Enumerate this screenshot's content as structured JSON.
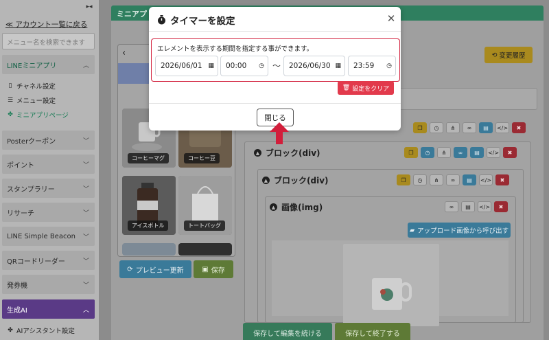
{
  "sidebar": {
    "collapse_label": "▸◂",
    "back_link": "≪ アカウント一覧に戻る",
    "search_placeholder": "メニュー名を検索できます",
    "groups": [
      {
        "label": "LINEミニアプリ"
      },
      {
        "label": "Posterクーポン"
      },
      {
        "label": "ポイント"
      },
      {
        "label": "スタンプラリー"
      },
      {
        "label": "リサーチ"
      },
      {
        "label": "LINE Simple Beacon"
      },
      {
        "label": "QRコードリーダー"
      },
      {
        "label": "発券機"
      },
      {
        "label": "生成AI"
      }
    ],
    "subitems": [
      {
        "label": "チャネル設定"
      },
      {
        "label": "メニュー設定"
      },
      {
        "label": "ミニアプリページ"
      },
      {
        "label": "AIアシスタント設定"
      }
    ]
  },
  "main": {
    "header_title": "ミニアプ",
    "history_button": "変更履歴",
    "preview_button": "プレビュー更新",
    "save_button": "保存",
    "products": [
      {
        "label": "コーヒーマグ"
      },
      {
        "label": "コーヒー豆"
      },
      {
        "label": "アイスボトル"
      },
      {
        "label": "トートバッグ"
      }
    ],
    "blocks": [
      {
        "title": "ブロック(div)"
      },
      {
        "title": "ブロック(div)"
      },
      {
        "title": "画像(img)"
      }
    ],
    "upload_button": "アップロード画像から呼び出す",
    "save_continue_button": "保存して編集を続ける",
    "save_finish_button": "保存して終了する"
  },
  "modal": {
    "title": "タイマーを設定",
    "description": "エレメントを表示する期間を指定する事ができます。",
    "start_date": "2026/06/01",
    "start_time": "00:00",
    "separator": "〜",
    "end_date": "2026/06/30",
    "end_time": "23:59",
    "clear_button": "設定をクリア",
    "close_button": "閉じる"
  },
  "colors": {
    "accent_green": "#2f7f5f",
    "danger_red": "#e23a4c",
    "highlight_border": "#d21e3b"
  }
}
